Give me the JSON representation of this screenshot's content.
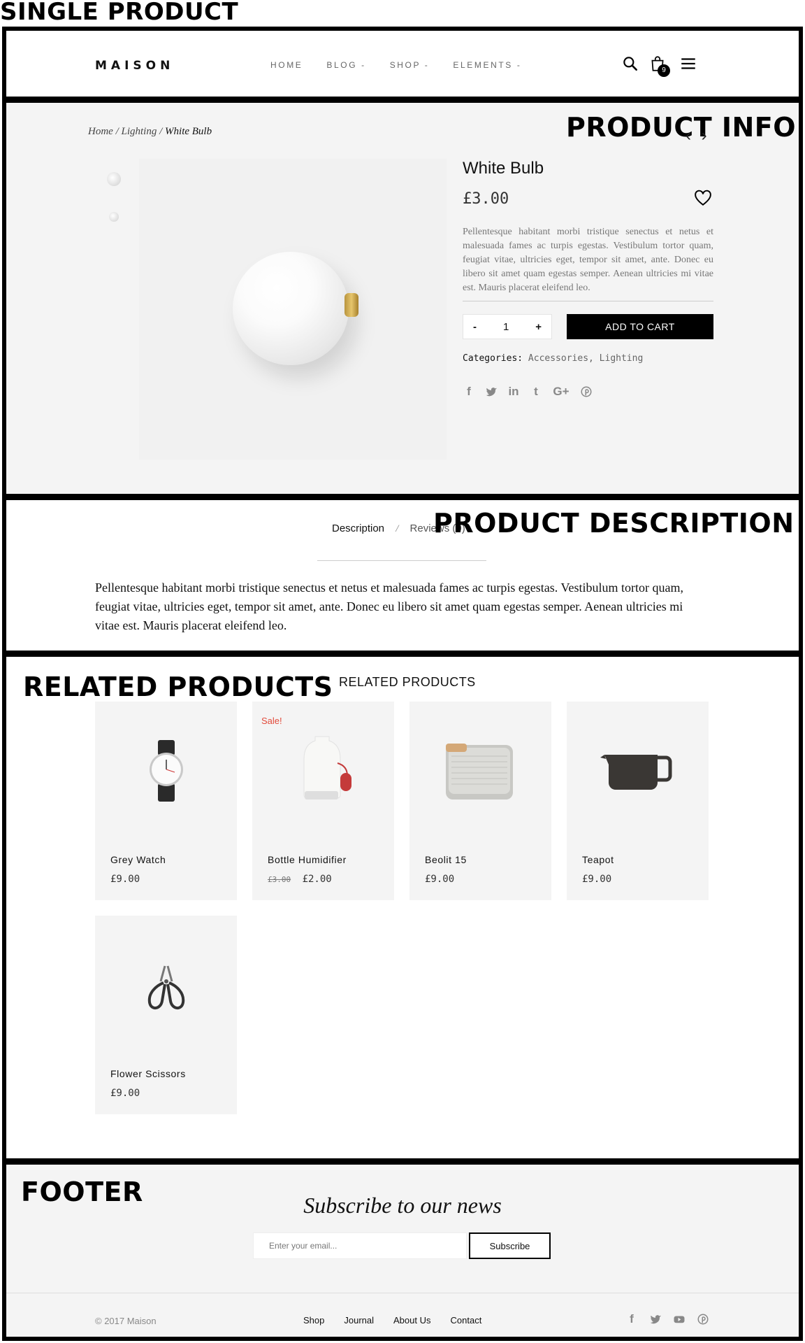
{
  "labels": {
    "single_product": "SINGLE PRODUCT",
    "product_info": "PRODUCT INFO",
    "product_description": "PRODUCT DESCRIPTION",
    "related_products": "RELATED PRODUCTS",
    "footer": "FOOTER"
  },
  "header": {
    "logo": "MAISON",
    "nav": [
      "HOME",
      "BLOG -",
      "SHOP -",
      "ELEMENTS -"
    ],
    "cart_count": "9",
    "icons": [
      "search-icon",
      "bag-icon",
      "menu-icon"
    ]
  },
  "product": {
    "breadcrumb": {
      "home": "Home",
      "sep": "/",
      "category": "Lighting",
      "current": "White Bulb"
    },
    "arrows": "‹ ›",
    "title": "White Bulb",
    "price": "£3.00",
    "text": "Pellentesque habitant morbi tristique senectus et netus et malesuada fames ac turpis egestas. Vestibulum tortor quam, feugiat vitae, ultricies eget, tempor sit amet, ante. Donec eu libero sit amet quam egestas semper. Aenean ultricies mi vitae est. Mauris placerat eleifend leo.",
    "qty_minus": "-",
    "qty_value": "1",
    "qty_plus": "+",
    "add_to_cart": "ADD TO CART",
    "categories_label": "Categories:",
    "categories_value": "Accessories, Lighting",
    "social": [
      "facebook-icon",
      "twitter-icon",
      "linkedin-icon",
      "tumblr-icon",
      "google-plus-icon",
      "pinterest-icon"
    ]
  },
  "description": {
    "tab_active": "Description",
    "tab_sep": "/",
    "tab_inactive": "Reviews (0)",
    "text": "Pellentesque habitant morbi tristique senectus et netus et malesuada fames ac turpis egestas. Vestibulum tortor quam, feugiat vitae, ultricies eget, tempor sit amet, ante. Donec eu libero sit amet quam egestas semper. Aenean ultricies mi vitae est. Mauris placerat eleifend leo."
  },
  "related": {
    "title": "RELATED PRODUCTS",
    "items": [
      {
        "name": "Grey Watch",
        "price": "£9.00"
      },
      {
        "name": "Bottle Humidifier",
        "old_price": "£3.00",
        "price": "£2.00",
        "badge": "Sale!"
      },
      {
        "name": "Beolit 15",
        "price": "£9.00"
      },
      {
        "name": "Teapot",
        "price": "£9.00"
      },
      {
        "name": "Flower Scissors",
        "price": "£9.00"
      }
    ]
  },
  "footer": {
    "subscribe_title": "Subscribe to our news",
    "email_placeholder": "Enter your email...",
    "subscribe_button": "Subscribe",
    "copyright": "© 2017 Maison",
    "links": [
      "Shop",
      "Journal",
      "About Us",
      "Contact"
    ],
    "social": [
      "facebook-icon",
      "twitter-icon",
      "youtube-icon",
      "pinterest-icon"
    ]
  }
}
